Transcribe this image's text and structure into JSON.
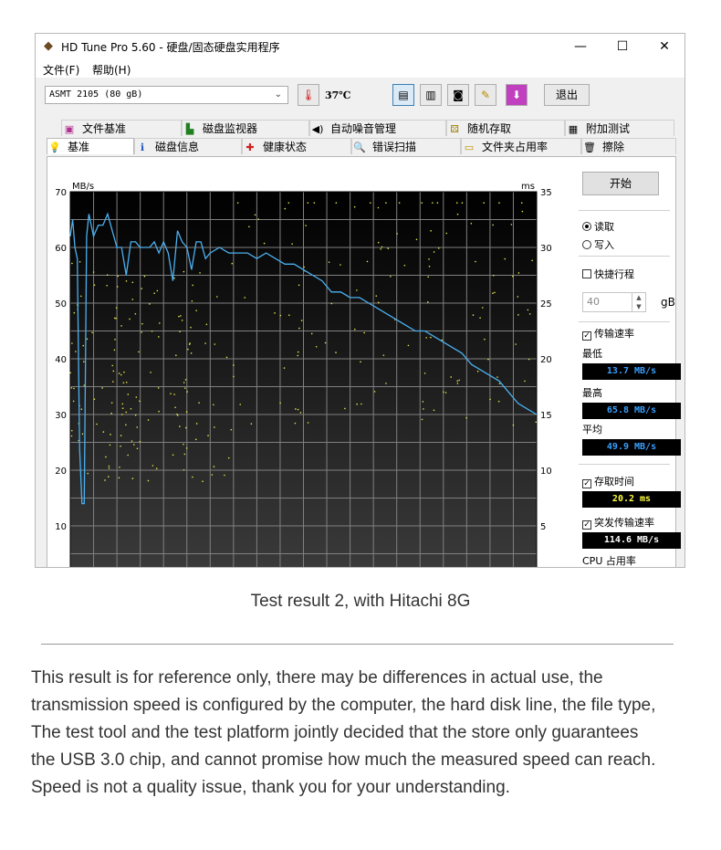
{
  "window": {
    "title": "HD Tune Pro 5.60 - 硬盘/固态硬盘实用程序",
    "controls": {
      "minimize": "—",
      "maximize": "☐",
      "close": "✕"
    }
  },
  "menu": {
    "file": "文件(F)",
    "help": "帮助(H)"
  },
  "toolbar": {
    "drive": "ASMT    2105 (80 gB)",
    "temperature": "37℃",
    "exit_label": "退出",
    "icons": [
      "thermometer-icon",
      "copy-text-icon",
      "copy-image-icon",
      "camera-icon",
      "options-icon",
      "save-icon"
    ]
  },
  "tabs": {
    "row1": [
      "文件基准",
      "磁盘监视器",
      "自动噪音管理",
      "随机存取",
      "附加测试"
    ],
    "row2": [
      "基准",
      "磁盘信息",
      "健康状态",
      "错误扫描",
      "文件夹占用率",
      "擦除"
    ],
    "active": "基准"
  },
  "side": {
    "start_label": "开始",
    "read_label": "读取",
    "write_label": "写入",
    "short_stroke_label": "快捷行程",
    "short_stroke_value": "40",
    "unit": "gB",
    "transfer_rate_label": "传输速率",
    "min_label": "最低",
    "min_value": "13.7 MB/s",
    "max_label": "最高",
    "max_value": "65.8 MB/s",
    "avg_label": "平均",
    "avg_value": "49.9 MB/s",
    "access_time_label": "存取时间",
    "access_time_value": "20.2 ms",
    "burst_label": "突发传输速率",
    "burst_value": "114.6 MB/s",
    "cpu_label": "CPU 占用率"
  },
  "chart_data": {
    "type": "line",
    "y_left_unit": "MB/s",
    "y_right_unit": "ms",
    "y_left_ticks": [
      10,
      20,
      30,
      40,
      50,
      60,
      70
    ],
    "y_right_ticks": [
      5,
      10,
      15,
      20,
      25,
      30,
      35
    ],
    "ylim": [
      0,
      70
    ],
    "y2lim": [
      0,
      35
    ],
    "grid": true,
    "series": [
      {
        "kind": "transfer-rate",
        "color": "#4ab0f0",
        "x": [
          0,
          0.5,
          1,
          1.5,
          2,
          2.5,
          3,
          3.5,
          4,
          5,
          6,
          7,
          8,
          9,
          10,
          11,
          12,
          13,
          14,
          15,
          16,
          17,
          18,
          19,
          20,
          21,
          22,
          23,
          24,
          25,
          26,
          27,
          28,
          29,
          30,
          32,
          34,
          36,
          38,
          40,
          42,
          44,
          46,
          48,
          50,
          52,
          54,
          56,
          58,
          60,
          62,
          64,
          66,
          68,
          70,
          72,
          74,
          76,
          78,
          80,
          82,
          84,
          86,
          88,
          90,
          92,
          94,
          96,
          98,
          100
        ],
        "y": [
          62,
          65,
          60,
          58,
          24,
          14,
          14,
          62,
          66,
          62,
          64,
          64,
          66,
          63,
          60,
          60,
          55,
          61,
          61,
          60,
          60,
          60,
          61,
          59,
          61,
          59,
          54,
          63,
          61,
          60,
          56,
          61,
          61,
          58,
          59,
          60,
          59,
          59,
          59,
          58,
          59,
          58,
          57,
          57,
          56,
          55,
          54,
          52,
          52,
          51,
          51,
          50,
          49,
          48,
          47,
          46,
          45,
          45,
          44,
          43,
          42,
          41,
          39,
          38,
          37,
          36,
          34,
          32,
          31,
          30
        ]
      },
      {
        "kind": "access-time",
        "color": "#e6e64a",
        "note": "scatter points, read on right axis"
      }
    ]
  },
  "caption": "Test result 2, with Hitachi 8G",
  "note_lines": [
    "This result is for reference only, there may be differences in actual use, the",
    "transmission speed is configured by the computer, the hard disk line, the file type,",
    "The test tool and the test platform jointly decided that the store only guarantees",
    "the USB 3.0 chip, and cannot promise how much the measured speed can reach.",
    "Speed is not a quality issue, thank you for your understanding."
  ]
}
